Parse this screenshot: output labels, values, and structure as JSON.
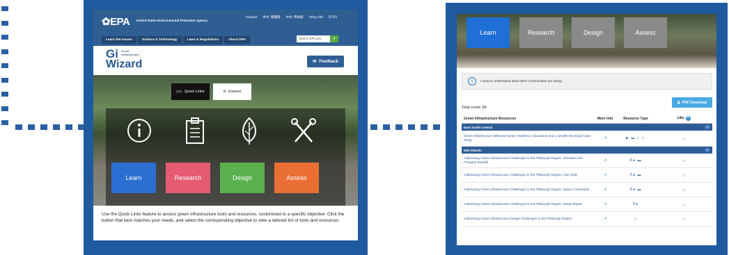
{
  "connector_color": "#2b5fa3",
  "frame_color": "#1f5a9e",
  "screen1": {
    "header": {
      "logo": "EPA",
      "agency": "United States Environmental Protection Agency",
      "languages": [
        "Español",
        "中文: 繁體版",
        "中文: 简体版",
        "Tiếng Việt",
        "한국어"
      ],
      "nav": [
        "Learn the Issues",
        "Science & Technology",
        "Laws & Regulations",
        "About EPA"
      ],
      "search_placeholder": "Search EPA.gov",
      "search_button_icon": "search-icon"
    },
    "gi": {
      "gi": "Gi",
      "small": "Green Infrastructure",
      "wizard": "Wizard",
      "feedback": "Feedback"
    },
    "hero": {
      "tabs": [
        {
          "label": "Quick Links",
          "icon": "double-play-icon"
        },
        {
          "label": "Explore",
          "icon": "compass-icon"
        }
      ],
      "icons": [
        "info-icon",
        "clipboard-icon",
        "leaf-icon",
        "tools-icon"
      ],
      "buttons": [
        {
          "label": "Learn",
          "color": "#2b6fd2"
        },
        {
          "label": "Research",
          "color": "#e45b72"
        },
        {
          "label": "Design",
          "color": "#5bb14f"
        },
        {
          "label": "Assess",
          "color": "#ea6f35"
        }
      ]
    },
    "description": "Use the Quick Links feature to access green infrastructure tools and resources, customized to a specific objective. Click the button that best matches your needs, and select the corresponding objective to view a tailored list of tools and resources."
  },
  "screen2": {
    "buttons": [
      {
        "label": "Learn",
        "color": "#1f6fd6"
      },
      {
        "label": "Research",
        "color": "#8a8a8a"
      },
      {
        "label": "Design",
        "color": "#8a8a8a"
      },
      {
        "label": "Assess",
        "color": "#8a8a8a"
      }
    ],
    "intro": "I want to understand what other communities are doing",
    "total_count": "Total count: 84",
    "pdf_download": "PDF Download",
    "columns": [
      "Green Infrastructure Resources",
      "More Info",
      "Resource Type",
      "Like"
    ],
    "groups": [
      {
        "name": "East South Central",
        "rows": [
          {
            "title": "Green Infrastructure Webcast Series: Models & Calculators and Louisville Municipal Case Study",
            "types": "▶ ▬ ◐ ▭"
          }
        ]
      },
      {
        "name": "Mid Atlantic",
        "rows": [
          {
            "title": "Addressing Green Infrastructure Challenges in the Pittsburgh Region: Abundant and Frequent Rainfall",
            "types": "Ä∎ ▬"
          },
          {
            "title": "Addressing Green Infrastructure Challenges in the Pittsburgh Region: Clay Soils",
            "types": "Ä∎ ▬"
          },
          {
            "title": "Addressing Green Infrastructure Challenges in the Pittsburgh Region: Space Constraints",
            "types": "Ä∎ ▬"
          },
          {
            "title": "Addressing Green Infrastructure Challenges in the Pittsburgh Region: Steep Slopes",
            "types": "Ä∎"
          },
          {
            "title": "Addressing Green Infrastructure Design Challenges in the Pittsburgh Region",
            "types": "▭"
          }
        ]
      }
    ]
  }
}
